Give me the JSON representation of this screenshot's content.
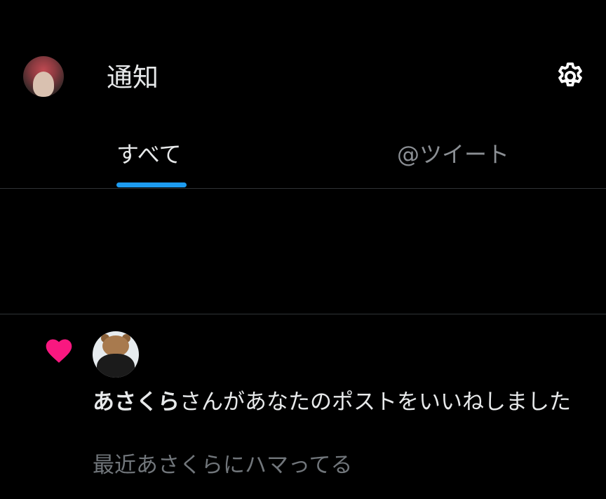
{
  "header": {
    "title": "通知"
  },
  "tabs": [
    {
      "label": "すべて",
      "selected": true
    },
    {
      "label": "@ツイート",
      "selected": false
    }
  ],
  "notification": {
    "icon": "heart-icon",
    "user_name": "あさくら",
    "action_text": "さんがあなたのポストをいいねしました",
    "post_preview": "最近あさくらにハマってる"
  },
  "colors": {
    "background": "#000000",
    "accent": "#1d9bf0",
    "like": "#f91880",
    "text_primary": "#e7e9ea",
    "text_secondary": "#71767b"
  }
}
